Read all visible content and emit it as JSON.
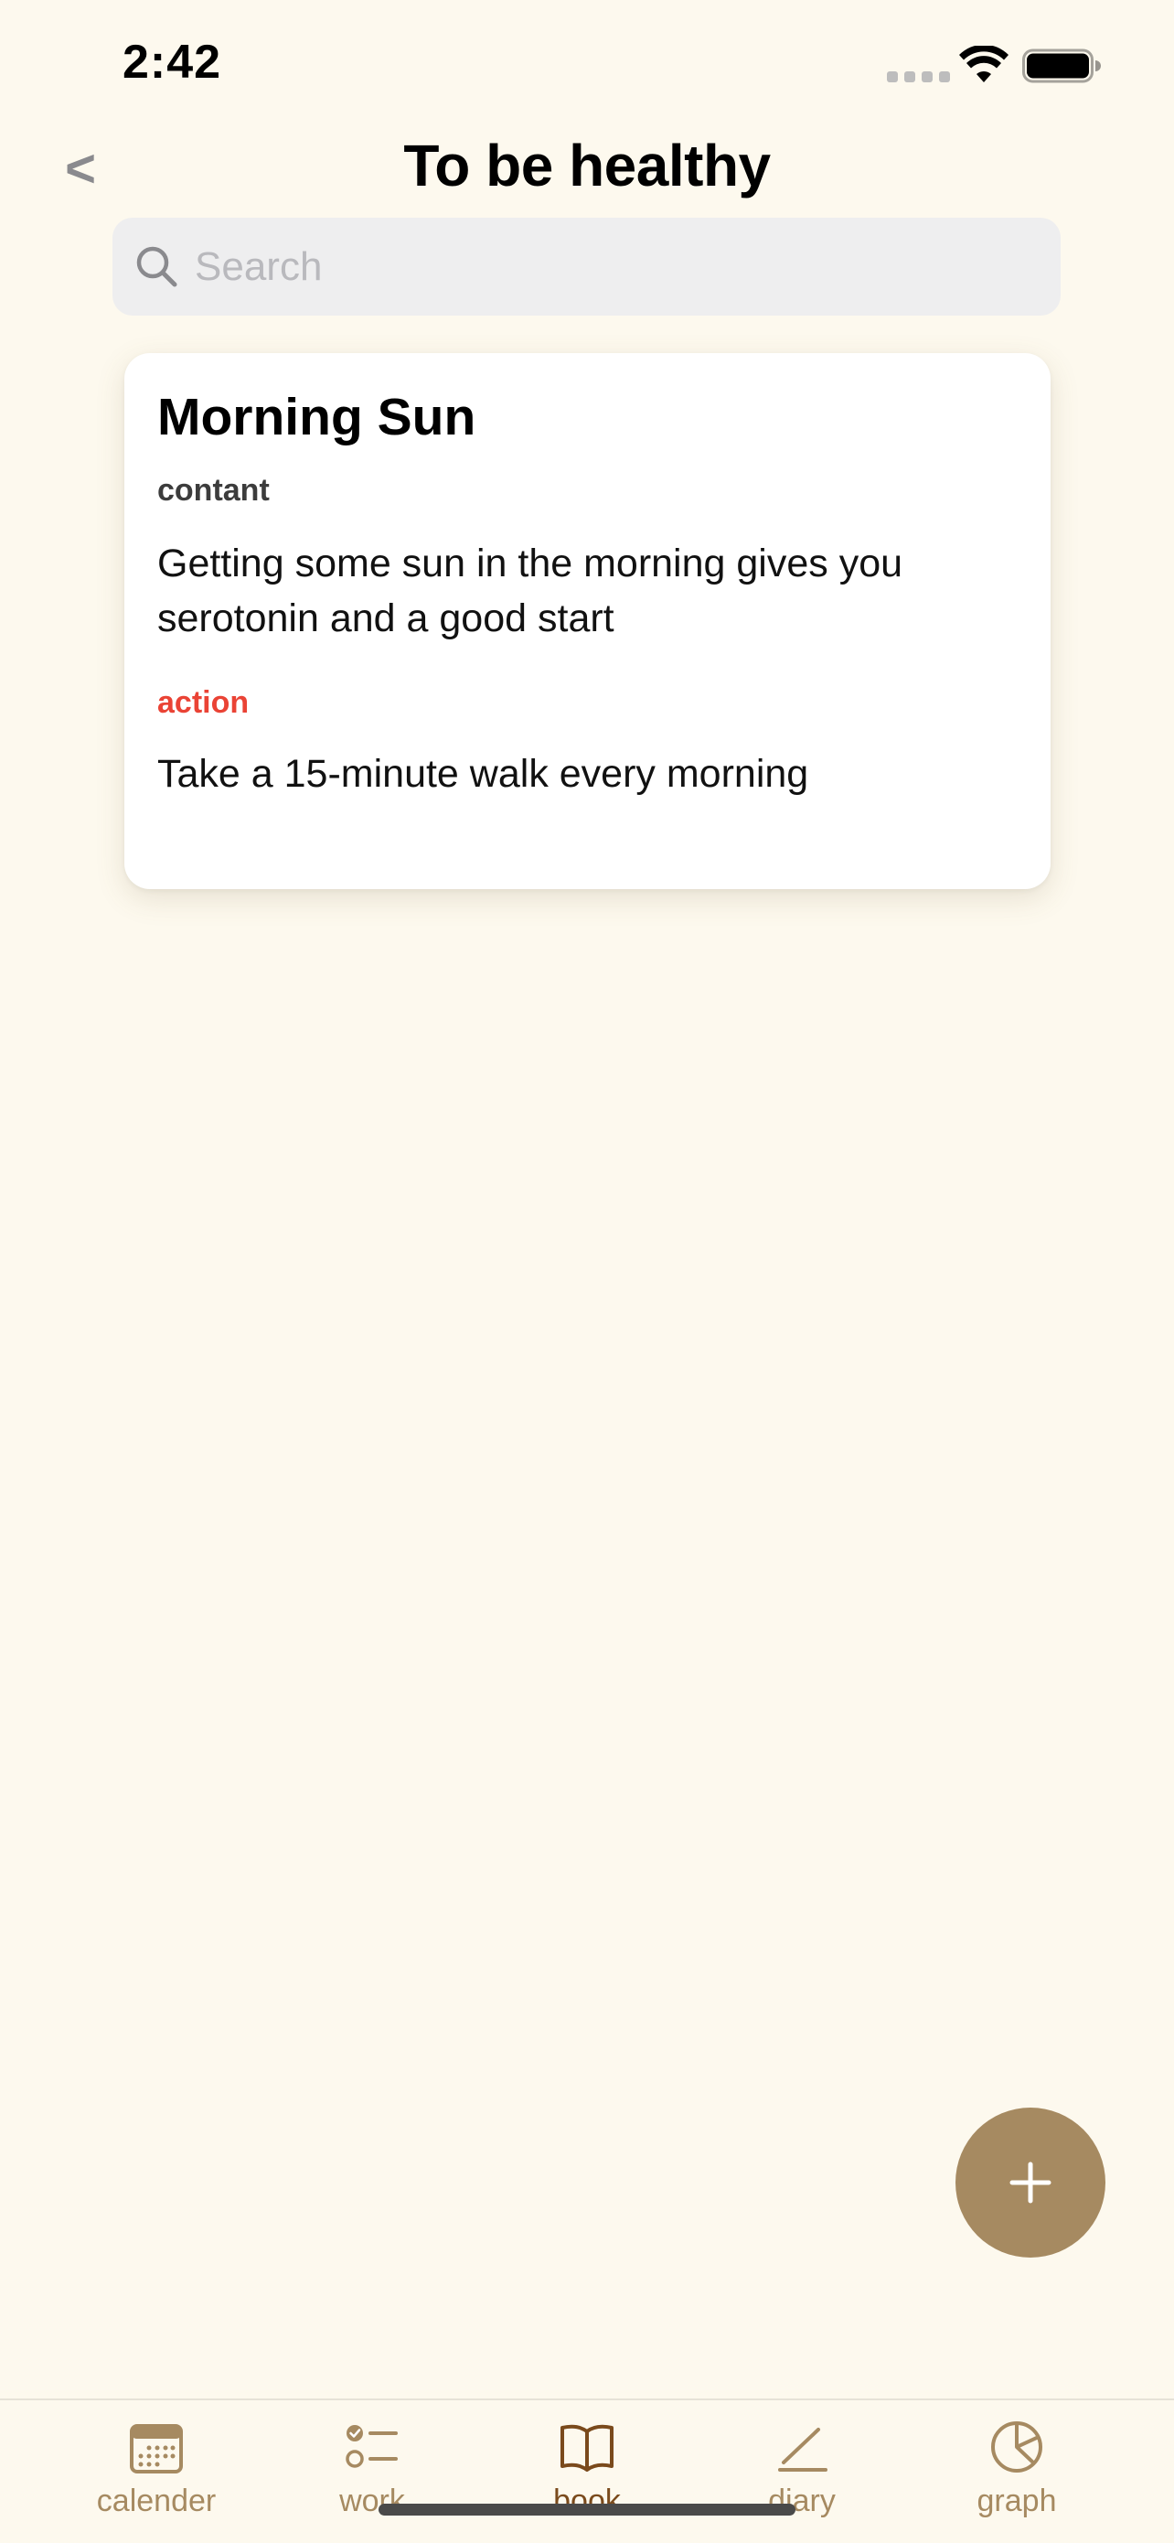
{
  "status_bar": {
    "time": "2:42"
  },
  "header": {
    "back_label": "<",
    "title": "To be healthy"
  },
  "search": {
    "placeholder": "Search",
    "value": ""
  },
  "card": {
    "title": "Morning Sun",
    "content_label": "contant",
    "content_text": "Getting some sun in the morning gives you serotonin and a good start",
    "action_label": "action",
    "action_text": "Take a 15-minute walk every morning"
  },
  "fab": {
    "icon": "plus-icon"
  },
  "tab_bar": {
    "items": [
      {
        "label": "calender",
        "icon": "calendar-icon",
        "active": false
      },
      {
        "label": "work",
        "icon": "checklist-icon",
        "active": false
      },
      {
        "label": "book",
        "icon": "book-icon",
        "active": true
      },
      {
        "label": "diary",
        "icon": "pencil-icon",
        "active": false
      },
      {
        "label": "graph",
        "icon": "pie-chart-icon",
        "active": false
      }
    ]
  },
  "colors": {
    "background": "#FDF9EE",
    "accent": "#A68A61",
    "active_tab": "#7A4A1C",
    "action_label": "#EA4335"
  }
}
